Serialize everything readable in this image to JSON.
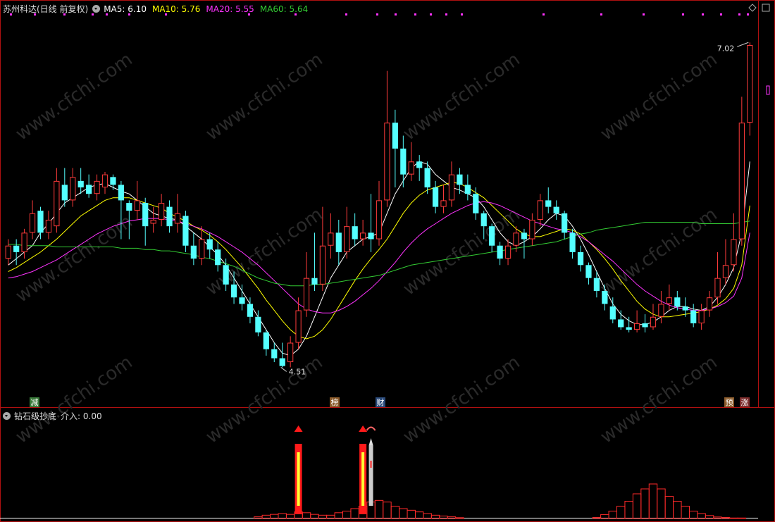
{
  "header": {
    "stock": "苏州科达(日线 前复权)",
    "ma5": "MA5: 6.10",
    "ma10": "MA10: 5.76",
    "ma20": "MA20: 5.55",
    "ma60": "MA60: 5.64"
  },
  "indicator": {
    "name": "钻石级抄底",
    "value": "介入: 0.00"
  },
  "colors": {
    "up": "#ff3b3b",
    "down": "#54ffff",
    "ma5": "#ffffff",
    "ma10": "#ffff00",
    "ma20": "#ff33ff",
    "ma60": "#33cc33",
    "frame": "#b01010",
    "event_dot": "#ff33ff"
  },
  "chart_data": {
    "type": "candlestick",
    "title": "苏州科达(日线 前复权)",
    "ylim": [
      4.3,
      7.25
    ],
    "price_labels": {
      "high": "7.02",
      "low": "4.51"
    },
    "event_markers": [
      "减",
      "榜",
      "财",
      "预",
      "涨"
    ],
    "candles": [
      [
        5.35,
        5.45,
        5.3,
        5.5
      ],
      [
        5.45,
        5.4,
        5.3,
        5.5
      ],
      [
        5.4,
        5.55,
        5.35,
        5.58
      ],
      [
        5.55,
        5.7,
        5.5,
        5.8
      ],
      [
        5.72,
        5.55,
        5.5,
        5.75
      ],
      [
        5.55,
        5.65,
        5.5,
        5.72
      ],
      [
        5.6,
        5.95,
        5.55,
        6.05
      ],
      [
        5.92,
        5.8,
        5.75,
        6.05
      ],
      [
        5.8,
        5.98,
        5.75,
        6.05
      ],
      [
        5.95,
        5.9,
        5.85,
        6.05
      ],
      [
        5.92,
        5.85,
        5.82,
        6.0
      ],
      [
        5.85,
        5.95,
        5.8,
        6.0
      ],
      [
        5.9,
        6.0,
        5.85,
        6.02
      ],
      [
        5.98,
        5.92,
        5.88,
        6.0
      ],
      [
        5.92,
        5.8,
        5.5,
        5.95
      ],
      [
        5.78,
        5.72,
        5.5,
        5.8
      ],
      [
        5.72,
        5.8,
        5.65,
        5.95
      ],
      [
        5.78,
        5.6,
        5.45,
        5.82
      ],
      [
        5.62,
        5.65,
        5.55,
        5.75
      ],
      [
        5.65,
        5.78,
        5.6,
        5.85
      ],
      [
        5.75,
        5.6,
        5.55,
        5.8
      ],
      [
        5.62,
        5.7,
        5.55,
        5.85
      ],
      [
        5.68,
        5.45,
        5.4,
        5.72
      ],
      [
        5.45,
        5.35,
        5.3,
        5.55
      ],
      [
        5.35,
        5.5,
        5.3,
        5.6
      ],
      [
        5.5,
        5.42,
        5.35,
        5.55
      ],
      [
        5.42,
        5.3,
        5.25,
        5.48
      ],
      [
        5.3,
        5.15,
        5.1,
        5.35
      ],
      [
        5.15,
        5.05,
        5.0,
        5.25
      ],
      [
        5.05,
        5.0,
        4.95,
        5.15
      ],
      [
        5.0,
        4.9,
        4.85,
        5.05
      ],
      [
        4.9,
        4.78,
        4.75,
        4.95
      ],
      [
        4.78,
        4.65,
        4.6,
        4.8
      ],
      [
        4.65,
        4.58,
        4.55,
        4.7
      ],
      [
        4.58,
        4.52,
        4.51,
        4.7
      ],
      [
        4.55,
        4.7,
        4.51,
        4.75
      ],
      [
        4.7,
        4.95,
        4.65,
        5.05
      ],
      [
        4.95,
        5.2,
        4.9,
        5.4
      ],
      [
        5.2,
        5.15,
        5.1,
        5.55
      ],
      [
        5.15,
        5.45,
        5.1,
        5.75
      ],
      [
        5.45,
        5.55,
        5.35,
        5.7
      ],
      [
        5.55,
        5.4,
        5.3,
        5.65
      ],
      [
        5.4,
        5.6,
        5.35,
        5.75
      ],
      [
        5.6,
        5.5,
        5.45,
        5.7
      ],
      [
        5.5,
        5.55,
        5.45,
        5.65
      ],
      [
        5.55,
        5.5,
        5.4,
        5.85
      ],
      [
        5.5,
        5.8,
        5.45,
        5.95
      ],
      [
        5.8,
        6.4,
        5.75,
        6.8
      ],
      [
        6.4,
        6.2,
        5.9,
        6.5
      ],
      [
        6.2,
        6.0,
        5.9,
        6.3
      ],
      [
        6.0,
        6.1,
        5.95,
        6.25
      ],
      [
        6.1,
        6.05,
        5.95,
        6.15
      ],
      [
        6.05,
        5.9,
        5.85,
        6.1
      ],
      [
        5.9,
        5.75,
        5.7,
        5.95
      ],
      [
        5.75,
        5.8,
        5.7,
        5.92
      ],
      [
        5.8,
        6.0,
        5.75,
        6.1
      ],
      [
        6.0,
        5.92,
        5.85,
        6.05
      ],
      [
        5.92,
        5.85,
        5.8,
        6.0
      ],
      [
        5.85,
        5.7,
        5.65,
        5.9
      ],
      [
        5.7,
        5.6,
        5.5,
        5.72
      ],
      [
        5.6,
        5.45,
        5.4,
        5.62
      ],
      [
        5.45,
        5.35,
        5.3,
        5.48
      ],
      [
        5.35,
        5.45,
        5.3,
        5.5
      ],
      [
        5.45,
        5.55,
        5.4,
        5.6
      ],
      [
        5.55,
        5.5,
        5.35,
        5.58
      ],
      [
        5.5,
        5.65,
        5.45,
        5.7
      ],
      [
        5.65,
        5.8,
        5.6,
        5.85
      ],
      [
        5.8,
        5.75,
        5.7,
        5.9
      ],
      [
        5.75,
        5.7,
        5.65,
        5.8
      ],
      [
        5.7,
        5.55,
        5.5,
        5.72
      ],
      [
        5.55,
        5.4,
        5.35,
        5.58
      ],
      [
        5.4,
        5.3,
        5.25,
        5.45
      ],
      [
        5.3,
        5.2,
        5.15,
        5.32
      ],
      [
        5.2,
        5.1,
        5.05,
        5.25
      ],
      [
        5.1,
        5.0,
        4.95,
        5.15
      ],
      [
        4.98,
        4.88,
        4.85,
        5.05
      ],
      [
        4.88,
        4.82,
        4.8,
        4.95
      ],
      [
        4.82,
        4.8,
        4.78,
        4.9
      ],
      [
        4.8,
        4.85,
        4.78,
        4.95
      ],
      [
        4.85,
        4.82,
        4.78,
        4.92
      ],
      [
        4.82,
        4.9,
        4.8,
        5.0
      ],
      [
        4.9,
        5.0,
        4.85,
        5.1
      ],
      [
        5.0,
        5.05,
        4.95,
        5.15
      ],
      [
        5.05,
        4.98,
        4.95,
        5.1
      ],
      [
        4.98,
        4.95,
        4.9,
        5.05
      ],
      [
        4.95,
        4.85,
        4.82,
        5.0
      ],
      [
        4.85,
        4.95,
        4.8,
        5.0
      ],
      [
        4.95,
        5.05,
        4.9,
        5.1
      ],
      [
        5.05,
        5.2,
        5.0,
        5.4
      ],
      [
        5.2,
        5.3,
        5.15,
        5.5
      ],
      [
        5.3,
        5.5,
        5.25,
        5.7
      ],
      [
        5.5,
        6.4,
        5.45,
        6.6
      ],
      [
        6.4,
        7.0,
        6.3,
        7.02
      ]
    ],
    "ma_series": [
      {
        "name": "MA5",
        "values": [
          5.3,
          5.35,
          5.4,
          5.45,
          5.55,
          5.62,
          5.7,
          5.78,
          5.82,
          5.86,
          5.9,
          5.92,
          5.93,
          5.9,
          5.87,
          5.85,
          5.8,
          5.75,
          5.7,
          5.68,
          5.66,
          5.65,
          5.6,
          5.55,
          5.5,
          5.44,
          5.38,
          5.3,
          5.2,
          5.1,
          5.0,
          4.9,
          4.8,
          4.7,
          4.62,
          4.6,
          4.65,
          4.75,
          4.9,
          5.05,
          5.2,
          5.3,
          5.4,
          5.45,
          5.5,
          5.52,
          5.55,
          5.7,
          5.85,
          5.95,
          6.05,
          6.1,
          6.08,
          6.0,
          5.95,
          5.9,
          5.88,
          5.85,
          5.82,
          5.75,
          5.65,
          5.55,
          5.48,
          5.45,
          5.48,
          5.52,
          5.58,
          5.65,
          5.7,
          5.68,
          5.6,
          5.5,
          5.38,
          5.25,
          5.12,
          5.0,
          4.92,
          4.87,
          4.84,
          4.84,
          4.86,
          4.9,
          4.95,
          4.98,
          4.98,
          4.96,
          4.95,
          4.98,
          5.05,
          5.15,
          5.28,
          5.55,
          6.1
        ]
      },
      {
        "name": "MA10",
        "values": [
          5.25,
          5.28,
          5.32,
          5.36,
          5.4,
          5.45,
          5.5,
          5.56,
          5.62,
          5.68,
          5.72,
          5.76,
          5.8,
          5.82,
          5.82,
          5.82,
          5.8,
          5.78,
          5.76,
          5.74,
          5.7,
          5.67,
          5.64,
          5.6,
          5.57,
          5.53,
          5.48,
          5.42,
          5.35,
          5.28,
          5.2,
          5.12,
          5.03,
          4.95,
          4.87,
          4.8,
          4.75,
          4.73,
          4.75,
          4.8,
          4.88,
          4.98,
          5.08,
          5.18,
          5.27,
          5.35,
          5.42,
          5.5,
          5.6,
          5.7,
          5.78,
          5.84,
          5.88,
          5.9,
          5.92,
          5.94,
          5.93,
          5.9,
          5.86,
          5.82,
          5.76,
          5.7,
          5.64,
          5.58,
          5.54,
          5.52,
          5.52,
          5.54,
          5.56,
          5.58,
          5.57,
          5.54,
          5.48,
          5.42,
          5.35,
          5.27,
          5.18,
          5.1,
          5.02,
          4.96,
          4.92,
          4.9,
          4.9,
          4.91,
          4.92,
          4.93,
          4.94,
          4.96,
          4.99,
          5.04,
          5.12,
          5.3,
          5.76
        ]
      },
      {
        "name": "MA20",
        "values": [
          5.2,
          5.21,
          5.23,
          5.25,
          5.28,
          5.31,
          5.34,
          5.38,
          5.42,
          5.46,
          5.5,
          5.54,
          5.57,
          5.6,
          5.62,
          5.64,
          5.65,
          5.66,
          5.66,
          5.66,
          5.65,
          5.64,
          5.62,
          5.6,
          5.58,
          5.55,
          5.52,
          5.48,
          5.44,
          5.4,
          5.35,
          5.3,
          5.24,
          5.18,
          5.12,
          5.06,
          5.0,
          4.96,
          4.94,
          4.93,
          4.93,
          4.95,
          4.98,
          5.02,
          5.07,
          5.12,
          5.18,
          5.25,
          5.32,
          5.4,
          5.47,
          5.53,
          5.58,
          5.62,
          5.66,
          5.7,
          5.73,
          5.76,
          5.78,
          5.79,
          5.78,
          5.76,
          5.73,
          5.7,
          5.67,
          5.64,
          5.62,
          5.6,
          5.58,
          5.57,
          5.55,
          5.52,
          5.48,
          5.43,
          5.38,
          5.33,
          5.27,
          5.21,
          5.15,
          5.1,
          5.06,
          5.02,
          4.99,
          4.97,
          4.96,
          4.95,
          4.95,
          4.96,
          4.98,
          5.01,
          5.06,
          5.2,
          5.55
        ]
      },
      {
        "name": "MA60",
        "values": [
          5.46,
          5.46,
          5.45,
          5.45,
          5.45,
          5.45,
          5.44,
          5.44,
          5.44,
          5.44,
          5.44,
          5.44,
          5.44,
          5.44,
          5.43,
          5.43,
          5.43,
          5.42,
          5.42,
          5.41,
          5.41,
          5.4,
          5.39,
          5.38,
          5.36,
          5.35,
          5.33,
          5.31,
          5.29,
          5.26,
          5.23,
          5.2,
          5.18,
          5.16,
          5.15,
          5.14,
          5.14,
          5.14,
          5.15,
          5.15,
          5.16,
          5.17,
          5.18,
          5.19,
          5.2,
          5.21,
          5.22,
          5.24,
          5.26,
          5.28,
          5.3,
          5.31,
          5.32,
          5.33,
          5.34,
          5.35,
          5.36,
          5.37,
          5.38,
          5.39,
          5.4,
          5.41,
          5.42,
          5.43,
          5.44,
          5.45,
          5.46,
          5.47,
          5.48,
          5.5,
          5.52,
          5.54,
          5.55,
          5.57,
          5.58,
          5.59,
          5.6,
          5.61,
          5.62,
          5.63,
          5.63,
          5.63,
          5.63,
          5.63,
          5.63,
          5.63,
          5.62,
          5.62,
          5.62,
          5.62,
          5.62,
          5.63,
          5.64
        ]
      }
    ],
    "indicator_bars": [
      0,
      0,
      0,
      0,
      0,
      0,
      0,
      0,
      0,
      0,
      0,
      0,
      0,
      0,
      0,
      0,
      0,
      0,
      0,
      0,
      0,
      0,
      0,
      0,
      0,
      0,
      0,
      0,
      0,
      0,
      0,
      2,
      4,
      5,
      6,
      5,
      8,
      7,
      5,
      4,
      4,
      7,
      9,
      12,
      15,
      20,
      22,
      20,
      15,
      12,
      10,
      8,
      6,
      4,
      3,
      2,
      1,
      0,
      0,
      0,
      0,
      0,
      0,
      0,
      0,
      0,
      0,
      0,
      0,
      0,
      0,
      0,
      0,
      0,
      0,
      0,
      0,
      0,
      0,
      0,
      0,
      0,
      0,
      0,
      0,
      0,
      0,
      0,
      0,
      0,
      0,
      0,
      0
    ],
    "indicator_bars_2": [
      0,
      0,
      0,
      0,
      0,
      0,
      0,
      0,
      0,
      0,
      0,
      0,
      0,
      0,
      0,
      0,
      0,
      0,
      0,
      0,
      0,
      0,
      0,
      0,
      0,
      0,
      0,
      0,
      0,
      0,
      0,
      0,
      0,
      0,
      0,
      0,
      0,
      0,
      0,
      0,
      0,
      0,
      0,
      0,
      0,
      0,
      0,
      0,
      0,
      0,
      0,
      0,
      0,
      0,
      0,
      0,
      0,
      0,
      0,
      0,
      0,
      0,
      0,
      0,
      0,
      0,
      0,
      0,
      0,
      0,
      0,
      0,
      0,
      2,
      8,
      15,
      25,
      35,
      50,
      60,
      70,
      60,
      45,
      35,
      25,
      15,
      10,
      6,
      3,
      2,
      1,
      1,
      0
    ]
  }
}
